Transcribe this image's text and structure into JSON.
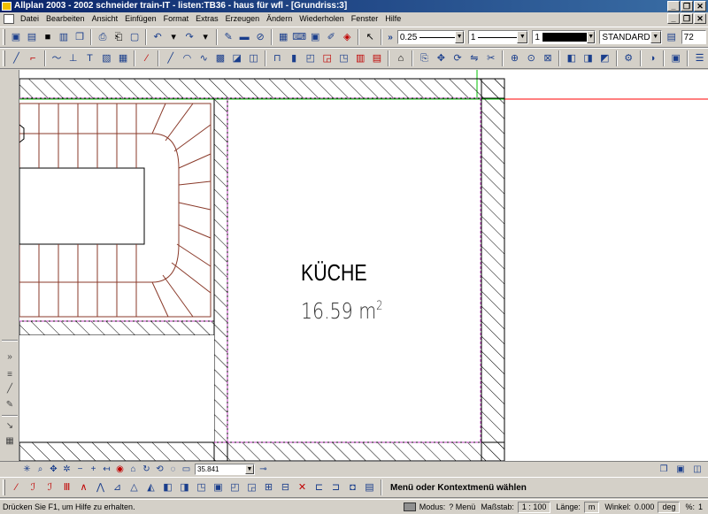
{
  "window": {
    "title": "Allplan 2003 - 2002 schneider train-IT - listen:TB36 - haus für wfl - [Grundriss:3]",
    "buttons": [
      "_",
      "❐",
      "✕"
    ]
  },
  "menubar": {
    "items": [
      "Datei",
      "Bearbeiten",
      "Ansicht",
      "Einfügen",
      "Format",
      "Extras",
      "Erzeugen",
      "Ändern",
      "Wiederholen",
      "Fenster",
      "Hilfe"
    ],
    "doc_buttons": [
      "_",
      "❐",
      "✕"
    ]
  },
  "format_bar": {
    "pen_thickness": "0.25",
    "line_type": "1",
    "color": "1",
    "layer": "STANDARD",
    "font_size": "72"
  },
  "drawing": {
    "room_name": "KÜCHE",
    "room_area": "16.59  m",
    "room_area_unit_exp": "2"
  },
  "snap_bar": {
    "coordinate": "35.841"
  },
  "dialog_line": {
    "prompt": "Menü oder Kontextmenü wählen"
  },
  "statusbar": {
    "help": "Drücken Sie F1, um Hilfe zu erhalten.",
    "modus_label": "Modus:",
    "modus_value": "? Menü",
    "massstab_label": "Maßstab:",
    "massstab_value": "1 : 100",
    "laenge_label": "Länge:",
    "laenge_value": "m",
    "winkel_label": "Winkel:",
    "winkel_value": "0.000",
    "winkel_unit": "deg",
    "percent_label": "%:",
    "percent_value": "1"
  },
  "colors": {
    "titlebar": "#0a246a",
    "wall_hatch": "#000000",
    "stair_line": "#8a3a2a",
    "guide_red": "#ff0000",
    "guide_green": "#00c000",
    "magenta": "#c040c0"
  }
}
